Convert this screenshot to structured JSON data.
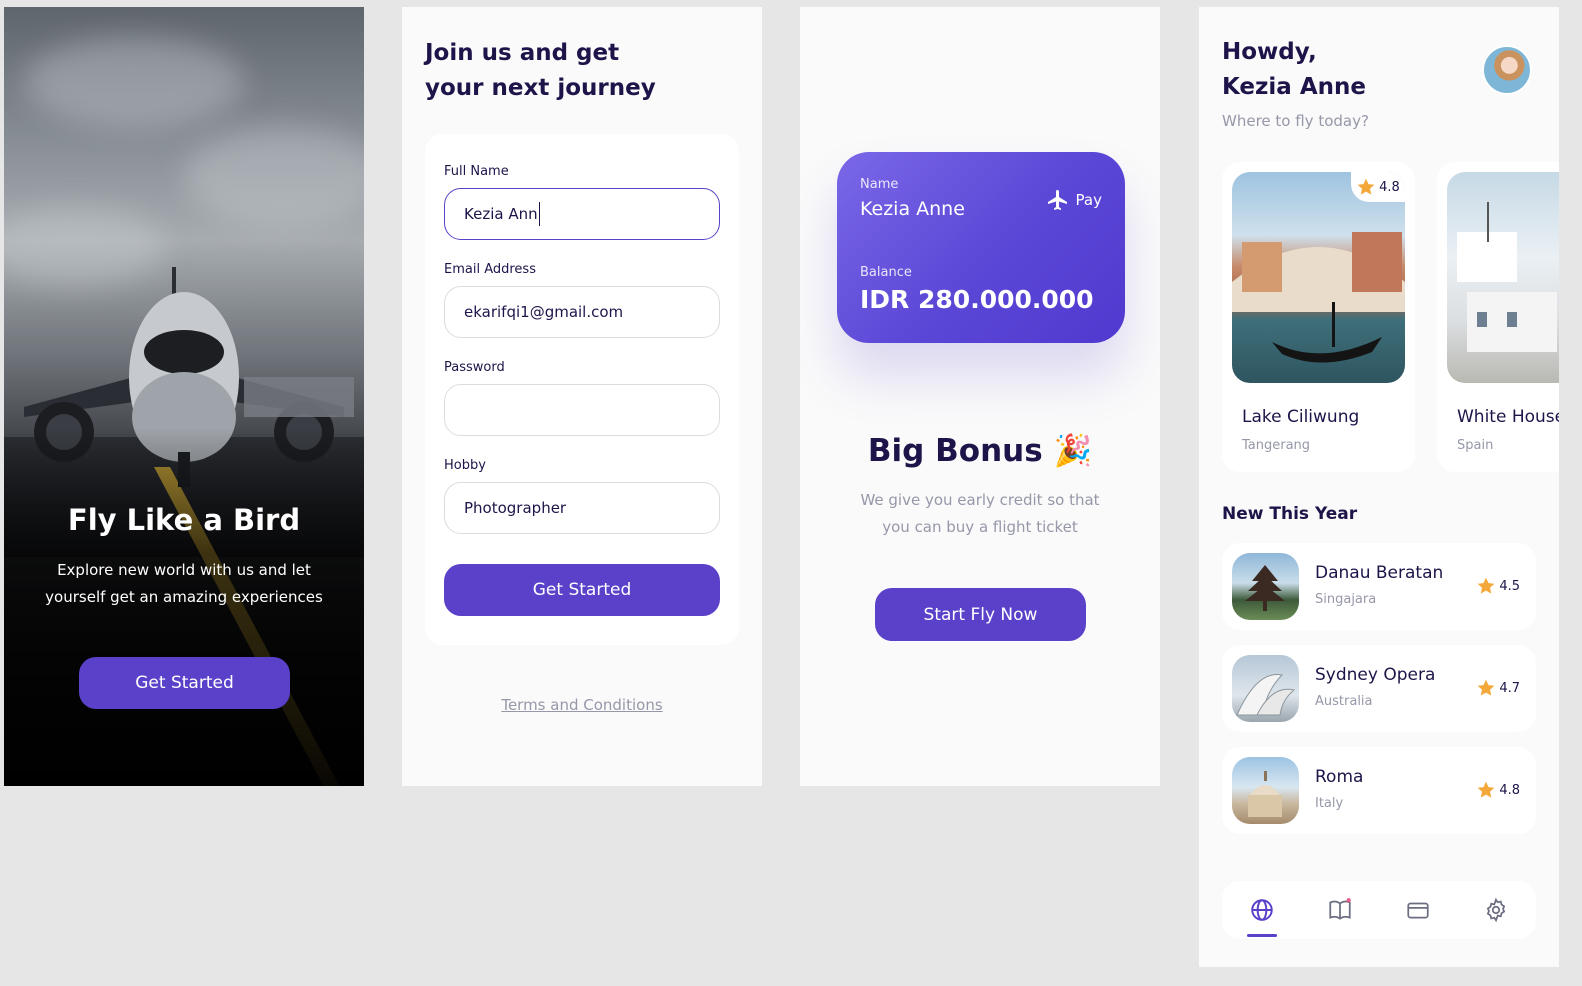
{
  "onboarding": {
    "title": "Fly Like a Bird",
    "subtitle": "Explore new world with us and let yourself get an amazing experiences",
    "button": "Get Started"
  },
  "signup": {
    "title_line1": "Join us and get",
    "title_line2": "your next journey",
    "fields": [
      {
        "label": "Full Name",
        "value": "Kezia Ann"
      },
      {
        "label": "Email Address",
        "value": "ekarifqi1@gmail.com"
      },
      {
        "label": "Password",
        "value": ""
      },
      {
        "label": "Hobby",
        "value": "Photographer"
      }
    ],
    "button": "Get Started",
    "terms": "Terms and Conditions"
  },
  "bonus": {
    "card": {
      "name_label": "Name",
      "name": "Kezia Anne",
      "pay_label": "Pay",
      "balance_label": "Balance",
      "balance": "IDR 280.000.000"
    },
    "title": "Big Bonus",
    "emoji": "🎉",
    "subtitle": "We give you early credit so that you can buy a flight ticket",
    "button": "Start Fly Now"
  },
  "home": {
    "greeting_line1": "Howdy,",
    "greeting_line2": "Kezia Anne",
    "subtitle": "Where to fly today?",
    "popular": [
      {
        "name": "Lake Ciliwung",
        "location": "Tangerang",
        "rating": "4.8"
      },
      {
        "name": "White House",
        "location": "Spain",
        "rating": ""
      }
    ],
    "section_title": "New This Year",
    "new_items": [
      {
        "name": "Danau Beratan",
        "location": "Singajara",
        "rating": "4.5"
      },
      {
        "name": "Sydney Opera",
        "location": "Australia",
        "rating": "4.7"
      },
      {
        "name": "Roma",
        "location": "Italy",
        "rating": "4.8"
      }
    ],
    "nav_icons": [
      "globe-icon",
      "book-icon",
      "card-icon",
      "gear-icon"
    ]
  },
  "colors": {
    "primary": "#5b41c9",
    "text": "#1f1449",
    "muted": "#9698a9",
    "star": "#f4a83a"
  }
}
